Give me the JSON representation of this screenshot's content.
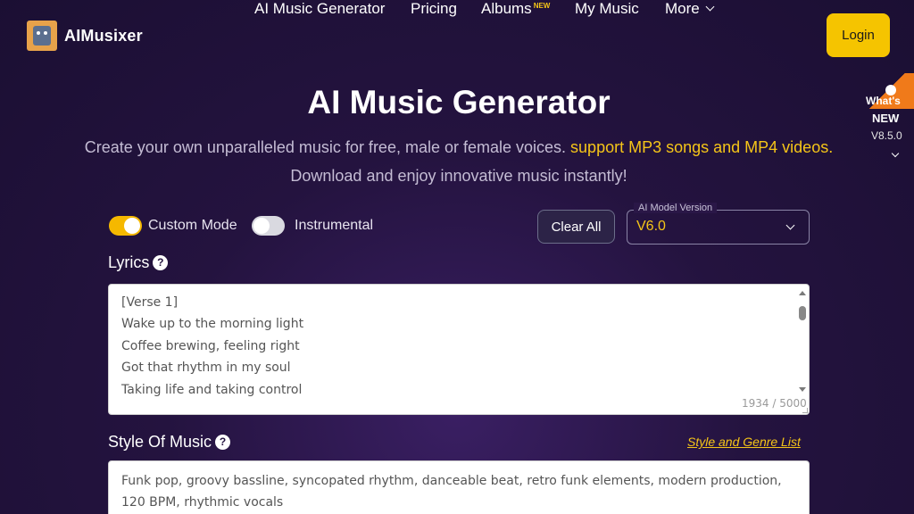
{
  "header": {
    "logo_text": "AIMusixer",
    "nav": {
      "generator": "AI Music Generator",
      "pricing": "Pricing",
      "albums": "Albums",
      "albums_badge": "NEW",
      "my_music": "My Music",
      "more": "More"
    },
    "login_label": "Login"
  },
  "whats_new": {
    "line1": "What's",
    "line2": "NEW",
    "version": "V8.5.0"
  },
  "hero": {
    "title": "AI Music Generator",
    "subtitle_part1": "Create your own unparalleled music for free, male or female voices.",
    "subtitle_highlight": "support MP3 songs and MP4 videos.",
    "subtitle_line2": "Download and enjoy innovative music instantly!"
  },
  "controls": {
    "custom_mode_label": "Custom Mode",
    "custom_mode_on": true,
    "instrumental_label": "Instrumental",
    "instrumental_on": false,
    "clear_all_label": "Clear All",
    "model_legend": "AI Model Version",
    "model_value": "V6.0"
  },
  "lyrics": {
    "label": "Lyrics",
    "lines": [
      "[Verse 1]",
      "Wake up to the morning light",
      "Coffee brewing, feeling right",
      "Got that rhythm in my soul",
      "Taking life and taking control"
    ],
    "counter": "1934 / 5000"
  },
  "style": {
    "label": "Style Of Music",
    "genre_link": "Style and Genre List",
    "text": "Funk pop, groovy bassline, syncopated rhythm, danceable beat, retro funk elements, modern production, 120 BPM, rhythmic vocals"
  },
  "colors": {
    "accent": "#f5c518",
    "toggle_on": "#f5b800",
    "toggle_off": "#d9d9e0",
    "background": "#24133f"
  }
}
